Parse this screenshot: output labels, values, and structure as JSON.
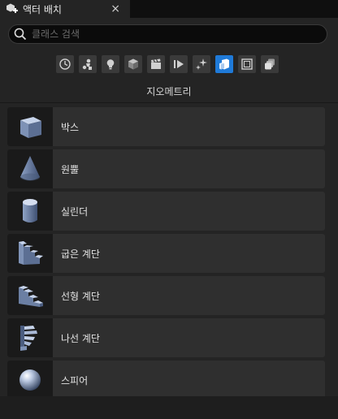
{
  "tab": {
    "title": "액터 배치",
    "close": "×"
  },
  "search": {
    "placeholder": "클래스 검색",
    "value": ""
  },
  "filters": [
    {
      "name": "recent",
      "icon": "clock-icon"
    },
    {
      "name": "basic",
      "icon": "actor-icon"
    },
    {
      "name": "lights",
      "icon": "lightbulb-icon"
    },
    {
      "name": "shapes",
      "icon": "cube-icon"
    },
    {
      "name": "cinematic",
      "icon": "clapper-icon"
    },
    {
      "name": "visual-effects",
      "icon": "play-icon"
    },
    {
      "name": "volumes",
      "icon": "sparkle-icon"
    },
    {
      "name": "geometry",
      "icon": "geometry-icon",
      "active": true
    },
    {
      "name": "all-classes",
      "icon": "frame-icon"
    },
    {
      "name": "stack",
      "icon": "stack-icon"
    }
  ],
  "section_title": "지오메트리",
  "items": [
    {
      "label": "박스",
      "icon": "box-icon"
    },
    {
      "label": "원뿔",
      "icon": "cone-icon"
    },
    {
      "label": "실린더",
      "icon": "cylinder-icon"
    },
    {
      "label": "굽은 계단",
      "icon": "curved-stairs-icon"
    },
    {
      "label": "선형 계단",
      "icon": "linear-stairs-icon"
    },
    {
      "label": "나선 계단",
      "icon": "spiral-stairs-icon"
    },
    {
      "label": "스피어",
      "icon": "sphere-icon"
    }
  ],
  "colors": {
    "accent": "#1f7ad8",
    "panel": "#242424",
    "item": "#2f2f2f"
  }
}
